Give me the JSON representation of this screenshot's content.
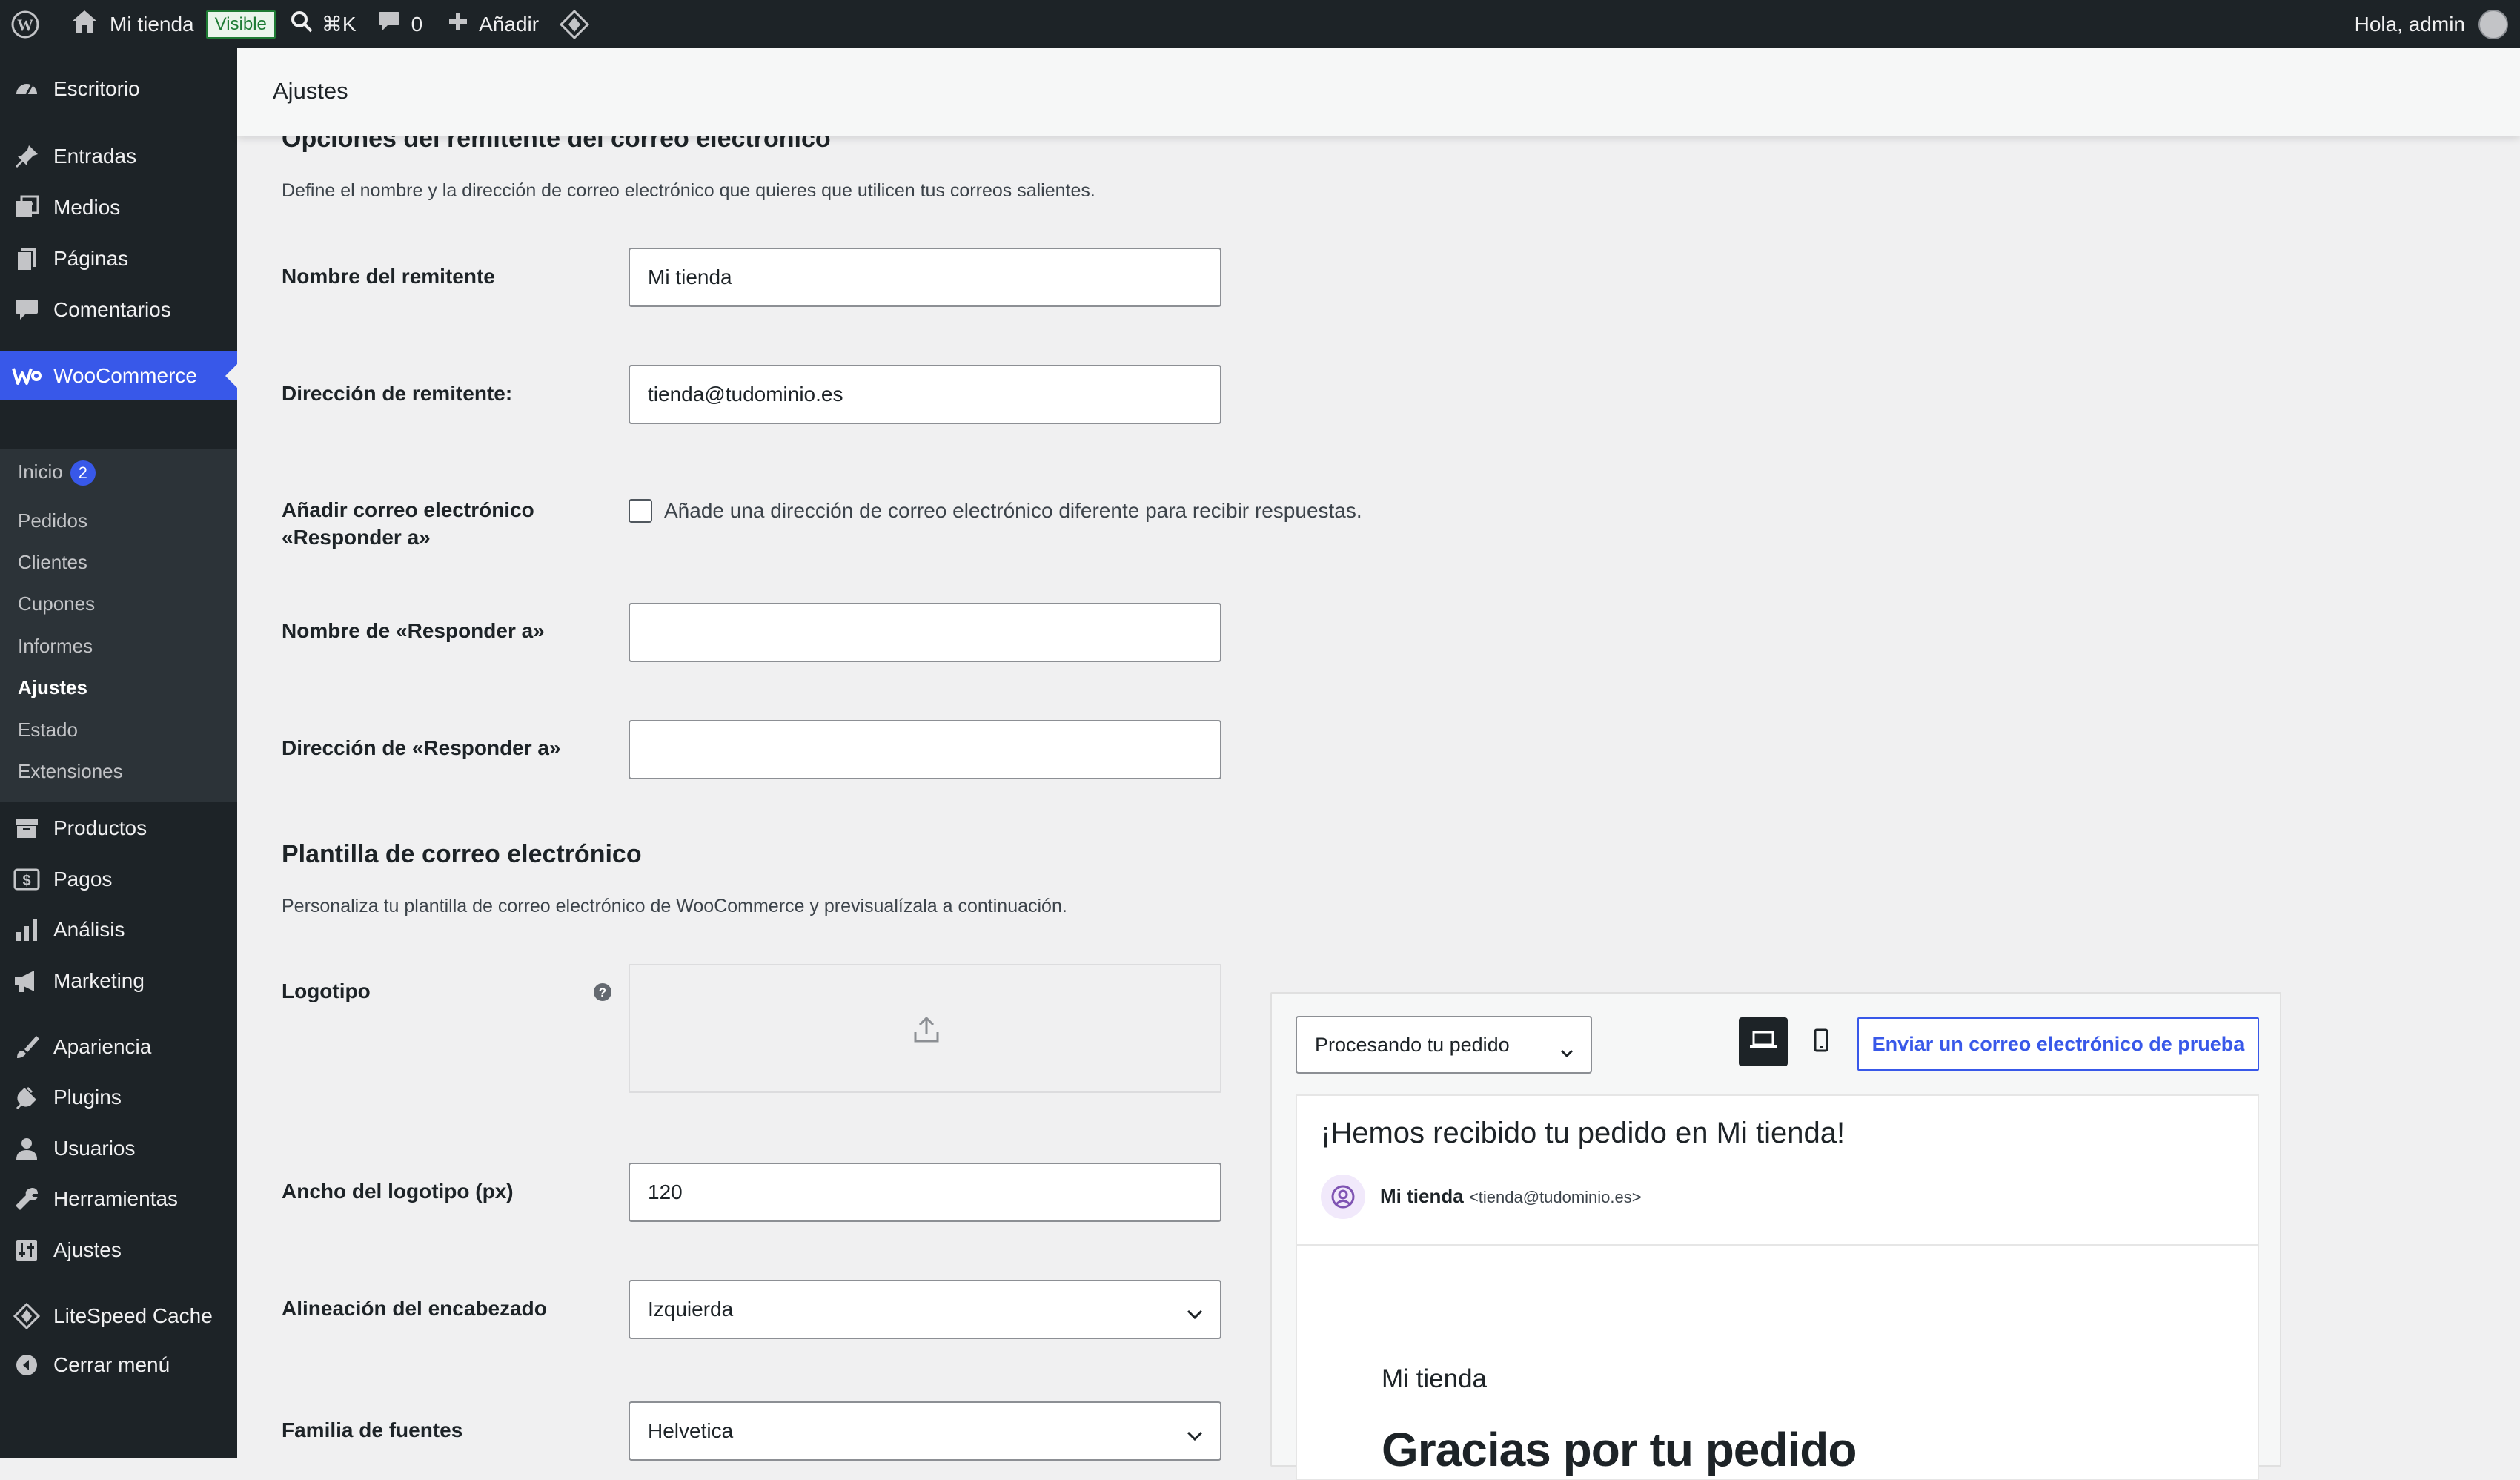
{
  "adminbar": {
    "site_name": "Mi tienda",
    "visibility_badge": "Visible",
    "search_shortcut": "⌘K",
    "comments_count": "0",
    "add_label": "Añadir",
    "greeting": "Hola, admin"
  },
  "sidebar": {
    "items": {
      "escritorio": "Escritorio",
      "entradas": "Entradas",
      "medios": "Medios",
      "paginas": "Páginas",
      "comentarios": "Comentarios",
      "woocommerce": "WooCommerce",
      "productos": "Productos",
      "pagos": "Pagos",
      "analisis": "Análisis",
      "marketing": "Marketing",
      "apariencia": "Apariencia",
      "plugins": "Plugins",
      "usuarios": "Usuarios",
      "herramientas": "Herramientas",
      "ajustes": "Ajustes",
      "litespeed": "LiteSpeed Cache",
      "cerrar": "Cerrar menú"
    },
    "woo_submenu": {
      "inicio": "Inicio",
      "inicio_badge": "2",
      "pedidos": "Pedidos",
      "clientes": "Clientes",
      "cupones": "Cupones",
      "informes": "Informes",
      "ajustes": "Ajustes",
      "estado": "Estado",
      "extensiones": "Extensiones"
    }
  },
  "header": {
    "title": "Ajustes"
  },
  "sender_section": {
    "title": "Opciones del remitente del correo electrónico",
    "description": "Define el nombre y la dirección de correo electrónico que quieres que utilicen tus correos salientes.",
    "from_name_label": "Nombre del remitente",
    "from_name_value": "Mi tienda",
    "from_address_label": "Dirección de remitente:",
    "from_address_value": "tienda@tudominio.es",
    "reply_to_label": "Añadir correo electrónico «Responder a»",
    "reply_to_checkbox_text": "Añade una dirección de correo electrónico diferente para recibir respuestas.",
    "reply_to_name_label": "Nombre de «Responder a»",
    "reply_to_name_value": "",
    "reply_to_address_label": "Dirección de «Responder a»",
    "reply_to_address_value": ""
  },
  "template_section": {
    "title": "Plantilla de correo electrónico",
    "description": "Personaliza tu plantilla de correo electrónico de WooCommerce y previsualízala a continuación.",
    "logo_label": "Logotipo",
    "logo_width_label": "Ancho del logotipo (px)",
    "logo_width_value": "120",
    "header_align_label": "Alineación del encabezado",
    "header_align_value": "Izquierda",
    "font_family_label": "Familia de fuentes",
    "font_family_value": "Helvetica"
  },
  "preview": {
    "email_type_selected": "Procesando tu pedido",
    "send_test_label": "Enviar un correo electrónico de prueba",
    "subject": "¡Hemos recibido tu pedido en Mi tienda!",
    "sender_name": "Mi tienda",
    "sender_email": "<tienda@tudominio.es>",
    "store_name": "Mi tienda",
    "heading": "Gracias por tu pedido"
  },
  "colors": {
    "admin_dark": "#1d2327",
    "accent": "#3858e9",
    "background": "#f0f0f1"
  }
}
